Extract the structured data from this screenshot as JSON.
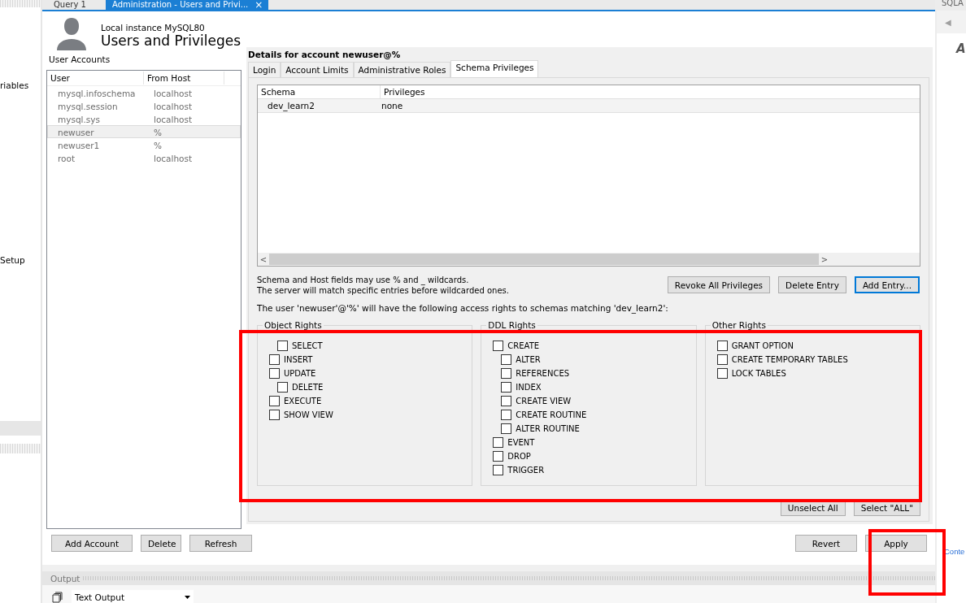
{
  "left_sidebar": {
    "items": [
      "riables",
      "Setup"
    ]
  },
  "editor_tabs": [
    {
      "label": "Query 1",
      "selected": false,
      "closable": false
    },
    {
      "label": "Administration - Users and Privi...",
      "selected": true,
      "closable": true
    }
  ],
  "close_glyph": "×",
  "header": {
    "subtitle": "Local instance MySQL80",
    "title": "Users and Privileges"
  },
  "user_accounts": {
    "label": "User Accounts",
    "columns": [
      "User",
      "From Host"
    ],
    "rows": [
      {
        "user": "mysql.infoschema",
        "host": "localhost",
        "selected": false
      },
      {
        "user": "mysql.session",
        "host": "localhost",
        "selected": false
      },
      {
        "user": "mysql.sys",
        "host": "localhost",
        "selected": false
      },
      {
        "user": "newuser",
        "host": "%",
        "selected": true
      },
      {
        "user": "newuser1",
        "host": "%",
        "selected": false
      },
      {
        "user": "root",
        "host": "localhost",
        "selected": false
      }
    ],
    "buttons": [
      "Add Account",
      "Delete",
      "Refresh"
    ]
  },
  "details": {
    "title": "Details for account newuser@%",
    "tabs": [
      {
        "label": "Login",
        "selected": false
      },
      {
        "label": "Account Limits",
        "selected": false
      },
      {
        "label": "Administrative Roles",
        "selected": false
      },
      {
        "label": "Schema Privileges",
        "selected": true
      }
    ],
    "schema_table": {
      "columns": [
        "Schema",
        "Privileges"
      ],
      "rows": [
        {
          "schema": "dev_learn2",
          "privileges": "none",
          "selected": true
        }
      ],
      "scroll_left": "<",
      "scroll_right": ">"
    },
    "note": [
      "Schema and Host fields may use % and _ wildcards.",
      "The server will match specific entries before wildcarded ones."
    ],
    "entry_buttons": [
      {
        "label": "Revoke All Privileges",
        "default": false
      },
      {
        "label": "Delete Entry",
        "default": false
      },
      {
        "label": "Add Entry...",
        "default": true
      }
    ],
    "access_line": "The user 'newuser'@'%' will have the following access rights to schemas matching 'dev_learn2':",
    "groups": [
      {
        "title": "Object Rights",
        "items": [
          {
            "label": "SELECT",
            "checked": false,
            "indented": true
          },
          {
            "label": "INSERT",
            "checked": false,
            "indented": false
          },
          {
            "label": "UPDATE",
            "checked": false,
            "indented": false,
            "children": [
              {
                "label": "DELETE",
                "checked": false,
                "indented": false
              }
            ]
          },
          {
            "label": "EXECUTE",
            "checked": false,
            "indented": false
          },
          {
            "label": "SHOW VIEW",
            "checked": false,
            "indented": false
          }
        ]
      },
      {
        "title": "DDL Rights",
        "items": [
          {
            "label": "CREATE",
            "checked": false,
            "indented": false,
            "children": [
              {
                "label": "ALTER",
                "checked": false,
                "indented": false
              },
              {
                "label": "REFERENCES",
                "checked": false,
                "indented": false
              },
              {
                "label": "INDEX",
                "checked": false,
                "indented": false
              },
              {
                "label": "CREATE VIEW",
                "checked": false,
                "indented": false
              },
              {
                "label": "CREATE ROUTINE",
                "checked": false,
                "indented": false
              },
              {
                "label": "ALTER ROUTINE",
                "checked": false,
                "indented": false
              }
            ]
          },
          {
            "label": "EVENT",
            "checked": false,
            "indented": false
          },
          {
            "label": "DROP",
            "checked": false,
            "indented": false
          },
          {
            "label": "TRIGGER",
            "checked": false,
            "indented": false
          }
        ]
      },
      {
        "title": "Other Rights",
        "items": [
          {
            "label": "GRANT OPTION",
            "checked": false,
            "indented": false
          },
          {
            "label": "CREATE TEMPORARY TABLES",
            "checked": false,
            "indented": false
          },
          {
            "label": "LOCK TABLES",
            "checked": false,
            "indented": false
          }
        ]
      }
    ],
    "select_buttons": [
      "Unselect All",
      "Select \"ALL\""
    ]
  },
  "footer_buttons": [
    "Revert",
    "Apply"
  ],
  "output": {
    "label": "Output",
    "selector": "Text Output"
  },
  "right_sidebar": {
    "tab": "SQLA",
    "arrow": "◀",
    "heading": "A",
    "link": "Conte"
  }
}
